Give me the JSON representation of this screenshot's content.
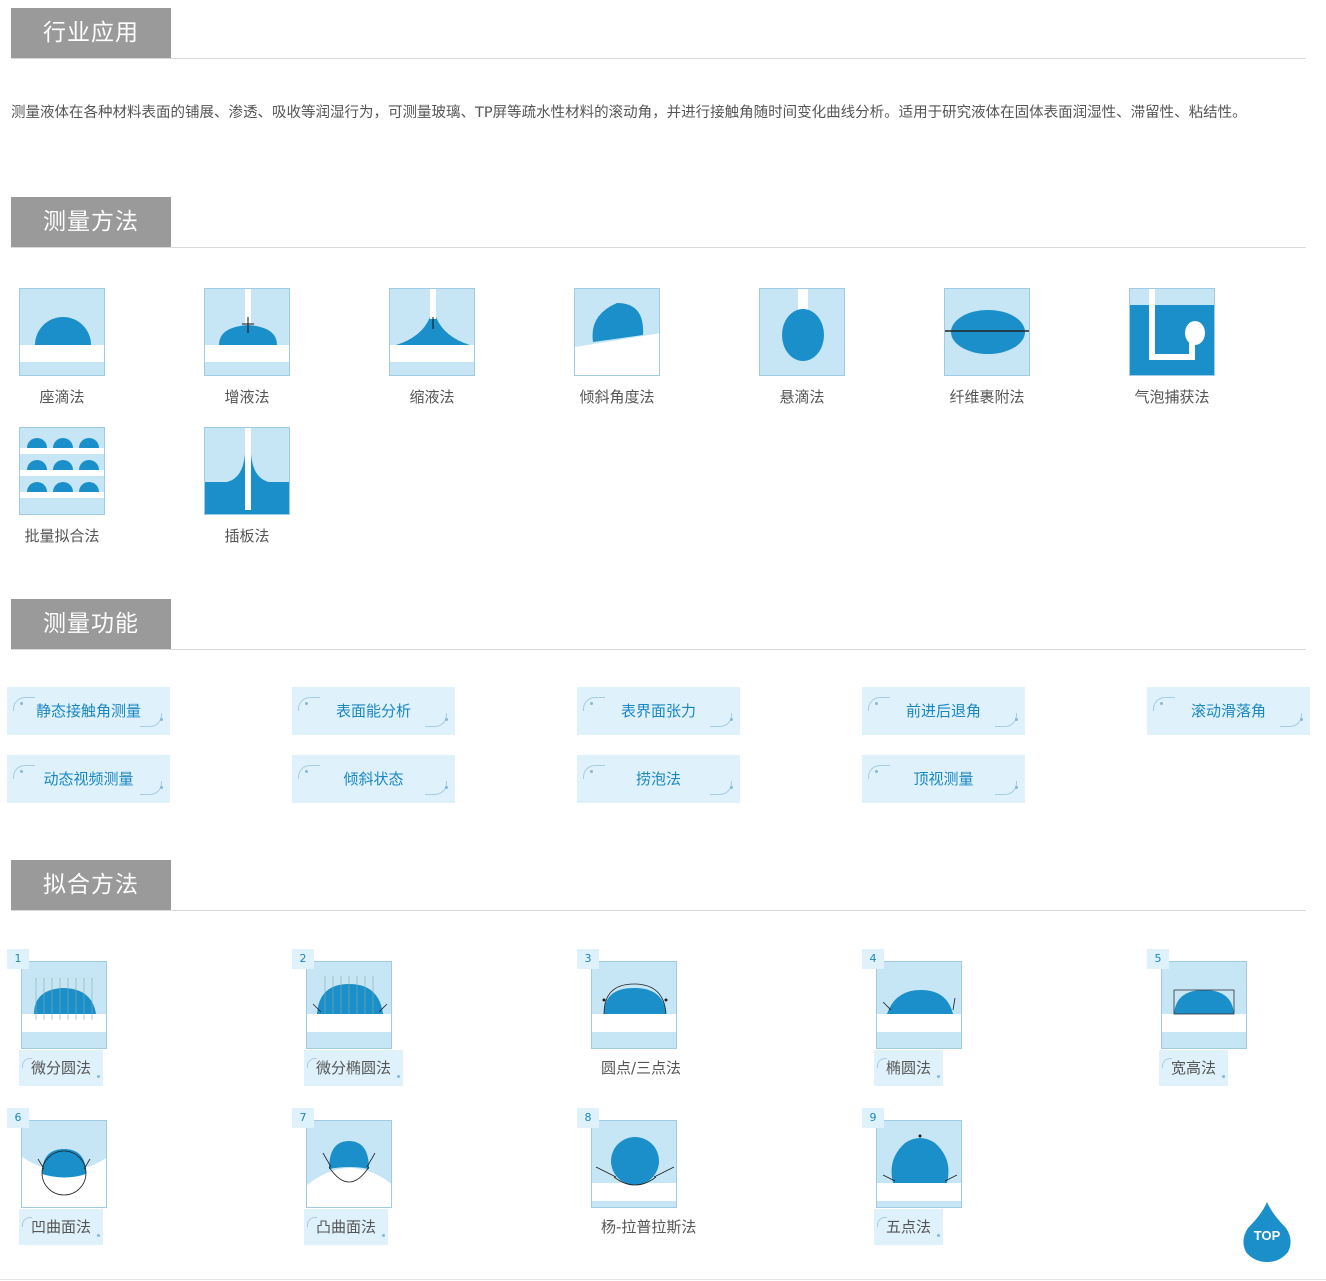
{
  "sections": {
    "industry": "行业应用",
    "methods": "测量方法",
    "functions": "测量功能",
    "fitting": "拟合方法"
  },
  "intro": "测量液体在各种材料表面的铺展、渗透、吸收等润湿行为，可测量玻璃、TP屏等疏水性材料的滚动角，并进行接触角随时间变化曲线分析。适用于研究液体在固体表面润湿性、滞留性、粘结性。",
  "methods": [
    {
      "label": "座滴法",
      "icon": "sessile-drop-icon"
    },
    {
      "label": "增液法",
      "icon": "add-liquid-icon"
    },
    {
      "label": "缩液法",
      "icon": "withdraw-liquid-icon"
    },
    {
      "label": "倾斜角度法",
      "icon": "tilt-angle-icon"
    },
    {
      "label": "悬滴法",
      "icon": "pendant-drop-icon"
    },
    {
      "label": "纤维裹附法",
      "icon": "fiber-icon"
    },
    {
      "label": "气泡捕获法",
      "icon": "captive-bubble-icon"
    },
    {
      "label": "批量拟合法",
      "icon": "batch-fit-icon"
    },
    {
      "label": "插板法",
      "icon": "plate-icon"
    }
  ],
  "functions": [
    "静态接触角测量",
    "表面能分析",
    "表界面张力",
    "前进后退角",
    "滚动滑落角",
    "动态视频测量",
    "倾斜状态",
    "捞泡法",
    "顶视测量"
  ],
  "fittings": [
    {
      "num": "1",
      "label": "微分圆法"
    },
    {
      "num": "2",
      "label": "微分椭圆法"
    },
    {
      "num": "3",
      "label": "圆点/三点法"
    },
    {
      "num": "4",
      "label": "椭圆法"
    },
    {
      "num": "5",
      "label": "宽高法"
    },
    {
      "num": "6",
      "label": "凹曲面法"
    },
    {
      "num": "7",
      "label": "凸曲面法"
    },
    {
      "num": "8",
      "label": "杨-拉普拉斯法"
    },
    {
      "num": "9",
      "label": "五点法"
    }
  ],
  "top_button": "TOP",
  "colors": {
    "drop": "#1a8fc9",
    "bg": "#c6e6f6",
    "tag": "#9a9a9a",
    "func_bg": "#dff1fb",
    "func_text": "#1a87c3"
  }
}
